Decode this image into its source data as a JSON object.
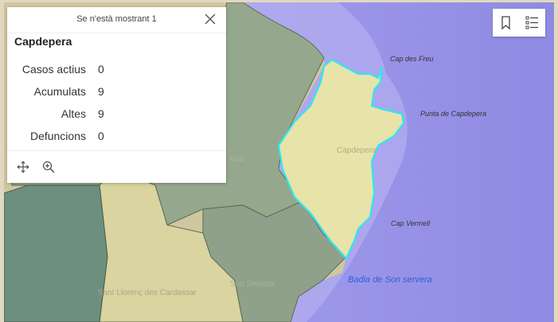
{
  "popup": {
    "header_text": "Se n'està mostrant 1",
    "title": "Capdepera",
    "fields": [
      {
        "label": "Casos actius",
        "value": "0"
      },
      {
        "label": "Acumulats",
        "value": "9"
      },
      {
        "label": "Altes",
        "value": "9"
      },
      {
        "label": "Defuncions",
        "value": "0"
      }
    ],
    "icons": [
      "close-icon",
      "pan-icon",
      "zoom-to-icon"
    ]
  },
  "toolbar": {
    "icons": [
      "bookmark-icon",
      "legend-list-icon"
    ]
  },
  "map": {
    "place_labels": {
      "cap_des_freu": "Cap des Freu",
      "punta_capdepera": "Punta de Capdepera",
      "capdepera": "Capdepera",
      "artà": "Artà",
      "cap_vermell": "Cap Vermell",
      "son_servera": "Son Servera",
      "sant_llorenc": "Sant Llorenç des Cardassar",
      "badia": "Badia de Son servera"
    },
    "colors": {
      "sea": "#9a95e8",
      "land": "#d7d0a6",
      "selected_region": "#e6e2a8",
      "highlight_outline": "#29e3f0",
      "region_green": "#91a58c",
      "region_teal": "#6c8f7e",
      "region_yellow": "#d8d3a1"
    }
  }
}
